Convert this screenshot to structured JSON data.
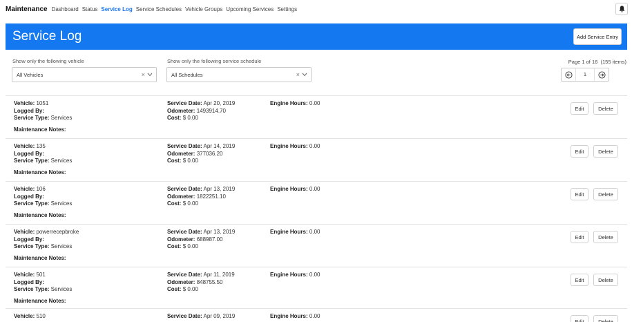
{
  "nav": {
    "brand": "Maintenance",
    "links": [
      "Dashboard",
      "Status",
      "Service Log",
      "Service Schedules",
      "Vehicle Groups",
      "Upcoming Services",
      "Settings"
    ],
    "active": "Service Log",
    "bell_icon": "bell-icon"
  },
  "header": {
    "title": "Service Log",
    "add_button": "Add Service Entry",
    "color": "#1479f0"
  },
  "filters": {
    "vehicle_label": "Show only the following vehicle",
    "vehicle_value": "All Vehicles",
    "schedule_label": "Show only the following service schedule",
    "schedule_value": "All Schedules"
  },
  "pagination": {
    "summary": "Page 1 of 16",
    "count": "(155 items)",
    "current_page": "1"
  },
  "labels": {
    "vehicle": "Vehicle:",
    "logged_by": "Logged By:",
    "service_type": "Service Type:",
    "notes": "Maintenance Notes:",
    "service_date": "Service Date:",
    "odometer": "Odometer:",
    "cost": "Cost:",
    "engine_hours": "Engine Hours:",
    "edit": "Edit",
    "delete": "Delete"
  },
  "entries": [
    {
      "vehicle": "1051",
      "logged_by": "",
      "service_type": "Services",
      "service_date": "Apr 20, 2019",
      "odometer": "1493914.70",
      "cost": "$ 0.00",
      "engine_hours": "0.00"
    },
    {
      "vehicle": "135",
      "logged_by": "",
      "service_type": "Services",
      "service_date": "Apr 14, 2019",
      "odometer": "377036.20",
      "cost": "$ 0.00",
      "engine_hours": "0.00"
    },
    {
      "vehicle": "106",
      "logged_by": "",
      "service_type": "Services",
      "service_date": "Apr 13, 2019",
      "odometer": "1822251.10",
      "cost": "$ 0.00",
      "engine_hours": "0.00"
    },
    {
      "vehicle": "powerrecepbroke",
      "logged_by": "",
      "service_type": "Services",
      "service_date": "Apr 13, 2019",
      "odometer": "688987.00",
      "cost": "$ 0.00",
      "engine_hours": "0.00"
    },
    {
      "vehicle": "501",
      "logged_by": "",
      "service_type": "Services",
      "service_date": "Apr 11, 2019",
      "odometer": "848755.50",
      "cost": "$ 0.00",
      "engine_hours": "0.00"
    },
    {
      "vehicle": "510",
      "logged_by": "",
      "service_type": "",
      "service_date": "Apr 09, 2019",
      "odometer": "",
      "cost": "",
      "engine_hours": "0.00"
    }
  ]
}
